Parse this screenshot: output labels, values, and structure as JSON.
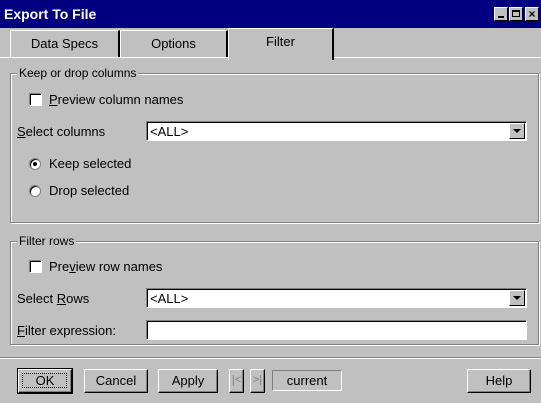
{
  "window": {
    "title": "Export To File"
  },
  "tabs": [
    {
      "label": "Data Specs"
    },
    {
      "label": "Options"
    },
    {
      "label": "Filter"
    }
  ],
  "keep_drop": {
    "legend": "Keep or drop columns",
    "preview_label_u": "P",
    "preview_label_rest": "review column names",
    "select_label_u": "S",
    "select_label_rest": "elect columns",
    "select_value": "<ALL>",
    "keep_label": "Keep selected",
    "drop_label": "Drop selected",
    "selected_option": "Keep selected"
  },
  "filter_rows": {
    "legend": "Filter rows",
    "preview_label_a": "Pre",
    "preview_label_u": "v",
    "preview_label_b": "iew row names",
    "select_label_a": "Select ",
    "select_label_u": "R",
    "select_label_b": "ows",
    "select_value": "<ALL>",
    "filter_label_u": "F",
    "filter_label_rest": "ilter expression:",
    "filter_value": ""
  },
  "buttons": {
    "ok": "OK",
    "cancel": "Cancel",
    "apply": "Apply",
    "first": "|<",
    "next": ">|",
    "current": "current",
    "help": "Help"
  }
}
